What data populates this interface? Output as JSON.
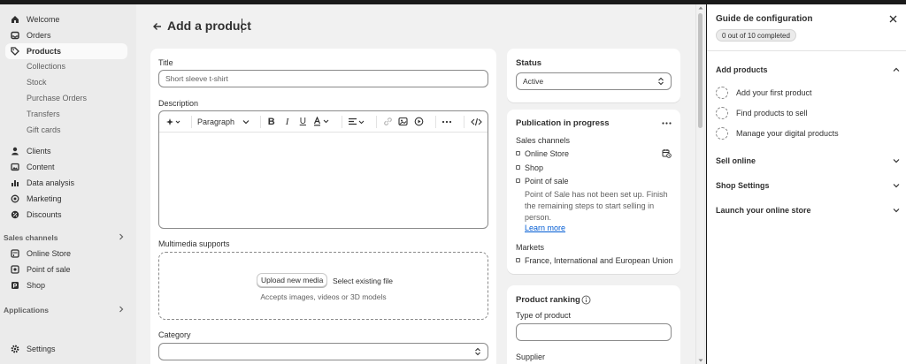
{
  "sidebar": {
    "items": [
      {
        "label": "Welcome",
        "icon": "home-icon"
      },
      {
        "label": "Orders",
        "icon": "inbox-icon"
      },
      {
        "label": "Products",
        "icon": "tag-icon",
        "active": true
      }
    ],
    "product_subitems": [
      "Collections",
      "Stock",
      "Purchase Orders",
      "Transfers",
      "Gift cards"
    ],
    "items2": [
      {
        "label": "Clients",
        "icon": "person-icon"
      },
      {
        "label": "Content",
        "icon": "image-icon"
      },
      {
        "label": "Data analysis",
        "icon": "bar-chart-icon"
      },
      {
        "label": "Marketing",
        "icon": "target-icon"
      },
      {
        "label": "Discounts",
        "icon": "discount-icon"
      }
    ],
    "sales_channels_label": "Sales channels",
    "channels": [
      {
        "label": "Online Store",
        "icon": "store-icon"
      },
      {
        "label": "Point of sale",
        "icon": "pos-icon"
      },
      {
        "label": "Shop",
        "icon": "shop-icon"
      }
    ],
    "applications_label": "Applications",
    "settings_label": "Settings"
  },
  "main": {
    "page_title": "Add a product",
    "title_label": "Title",
    "title_value": "Short sleeve t-shirt",
    "description_label": "Description",
    "paragraph_label": "Paragraph",
    "media_label": "Multimedia supports",
    "upload_label": "Upload new media",
    "select_existing_label": "Select existing file",
    "media_hint": "Accepts images, videos or 3D models",
    "category_label": "Category",
    "status": {
      "title": "Status",
      "value": "Active"
    },
    "publication": {
      "title": "Publication in progress",
      "sales_channels_label": "Sales channels",
      "channels": [
        "Online Store",
        "Shop",
        "Point of sale"
      ],
      "pos_note_lines": [
        "Point of Sale has not been set up. Finish",
        "the remaining steps to start selling in",
        "person."
      ],
      "learn_more": "Learn more",
      "markets_label": "Markets",
      "markets_value": "France, International and European Union"
    },
    "ranking": {
      "title": "Product ranking",
      "type_label": "Type of product",
      "supplier_label": "Supplier"
    }
  },
  "guide": {
    "title": "Guide de configuration",
    "progress": "0 out of 10 completed",
    "sections": [
      {
        "label": "Add products",
        "expanded": true,
        "tasks": [
          "Add your first product",
          "Find products to sell",
          "Manage your digital products"
        ]
      },
      {
        "label": "Sell online"
      },
      {
        "label": "Shop Settings"
      },
      {
        "label": "Launch your online store"
      }
    ]
  }
}
